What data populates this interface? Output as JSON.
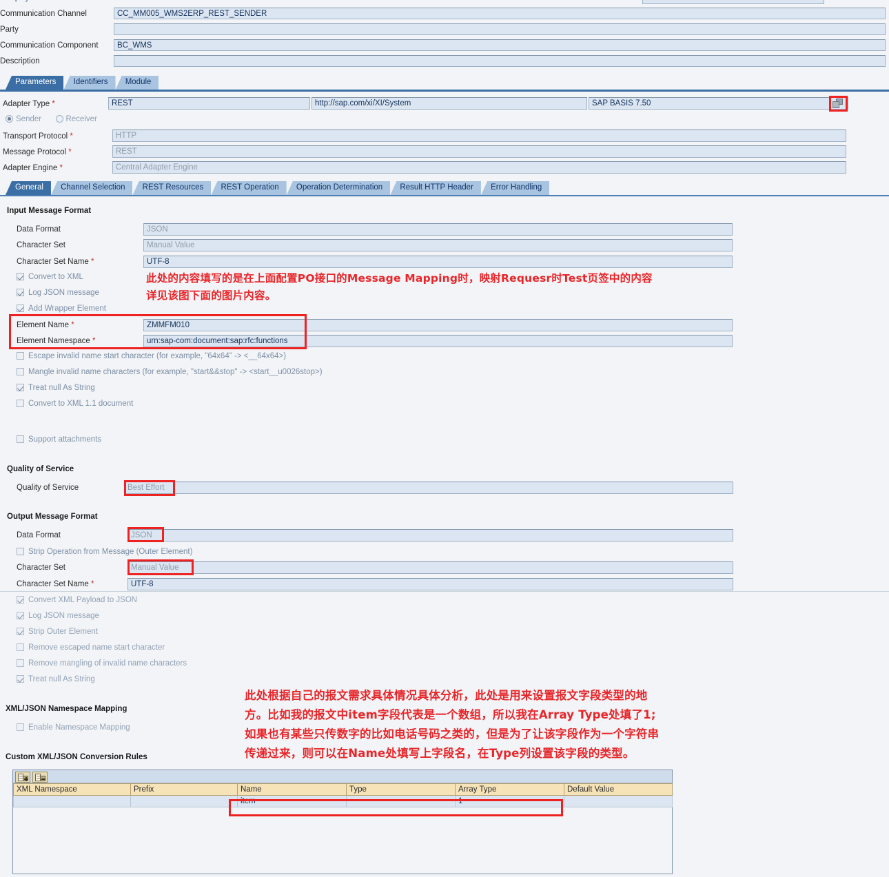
{
  "header": {
    "fields": [
      {
        "label": "Communication Channel",
        "value": "CC_MM005_WMS2ERP_REST_SENDER"
      },
      {
        "label": "Party",
        "value": ""
      },
      {
        "label": "Communication Component",
        "value": "BC_WMS"
      },
      {
        "label": "Description",
        "value": ""
      }
    ]
  },
  "main_tabs": [
    {
      "label": "Parameters",
      "active": true
    },
    {
      "label": "Identifiers",
      "active": false
    },
    {
      "label": "Module",
      "active": false
    }
  ],
  "adapter": {
    "type_label": "Adapter Type",
    "type_value": "REST",
    "type_namespace": "http://sap.com/xi/XI/System",
    "type_swcv": "SAP BASIS 7.50",
    "browse_icon": "stacked-squares-icon",
    "direction": {
      "sender": "Sender",
      "receiver": "Receiver",
      "selected": "Sender"
    },
    "rows": [
      {
        "label": "Transport Protocol",
        "value": "HTTP",
        "required": true
      },
      {
        "label": "Message Protocol",
        "value": "REST",
        "required": true
      },
      {
        "label": "Adapter Engine",
        "value": "Central Adapter Engine",
        "required": true
      }
    ]
  },
  "sub_tabs": [
    {
      "label": "General",
      "active": true
    },
    {
      "label": "Channel Selection",
      "active": false
    },
    {
      "label": "REST Resources",
      "active": false
    },
    {
      "label": "REST Operation",
      "active": false
    },
    {
      "label": "Operation Determination",
      "active": false
    },
    {
      "label": "Result HTTP Header",
      "active": false
    },
    {
      "label": "Error Handling",
      "active": false
    }
  ],
  "input_message_format": {
    "title": "Input Message Format",
    "data_format_label": "Data Format",
    "data_format_value": "JSON",
    "character_set_label": "Character Set",
    "character_set_value": "Manual Value",
    "character_set_name_label": "Character Set Name",
    "character_set_name_value": "UTF-8",
    "checkboxes": [
      {
        "label": "Convert to XML",
        "checked": true
      },
      {
        "label": "Log JSON message",
        "checked": true
      },
      {
        "label": "Add Wrapper Element",
        "checked": true
      }
    ],
    "element_name_label": "Element Name",
    "element_name_value": "ZMMFM010",
    "element_namespace_label": "Element Namespace",
    "element_namespace_value": "urn:sap-com:document:sap:rfc:functions",
    "checkboxes2": [
      {
        "label": "Escape invalid name start character (for example, \"64x64\" -> <__64x64>)",
        "checked": false
      },
      {
        "label": "Mangle invalid name characters (for example, \"start&&stop\" -> <start__u0026stop>)",
        "checked": false
      },
      {
        "label": "Treat null As String",
        "checked": true
      },
      {
        "label": "Convert to XML 1.1 document",
        "checked": false
      }
    ],
    "support_attachments": {
      "label": "Support attachments",
      "checked": false
    }
  },
  "quality_of_service": {
    "title": "Quality of Service",
    "label": "Quality of Service",
    "value": "Best Effort"
  },
  "output_message_format": {
    "title": "Output Message Format",
    "data_format_label": "Data Format",
    "data_format_value": "JSON",
    "strip_operation": {
      "label": "Strip Operation from Message (Outer Element)",
      "checked": false
    },
    "character_set_label": "Character Set",
    "character_set_value": "Manual Value",
    "character_set_name_label": "Character Set Name",
    "character_set_name_value": "UTF-8",
    "checkboxes": [
      {
        "label": "Convert XML Payload to JSON",
        "checked": true
      },
      {
        "label": "Log JSON message",
        "checked": true
      },
      {
        "label": "Strip Outer Element",
        "checked": true
      },
      {
        "label": "Remove escaped name start character",
        "checked": false
      },
      {
        "label": "Remove mangling of invalid name characters",
        "checked": false
      },
      {
        "label": "Treat null As String",
        "checked": true
      }
    ]
  },
  "namespace_mapping": {
    "title": "XML/JSON Namespace Mapping",
    "enable": {
      "label": "Enable Namespace Mapping",
      "checked": false
    }
  },
  "conversion_rules": {
    "title": "Custom XML/JSON Conversion Rules",
    "toolbar": [
      {
        "icon": "add-row-icon",
        "name": "add-row"
      },
      {
        "icon": "delete-row-icon",
        "name": "delete-row"
      }
    ],
    "columns": [
      "XML Namespace",
      "Prefix",
      "Name",
      "Type",
      "Array Type",
      "Default Value"
    ],
    "rows": [
      {
        "xml_namespace": "",
        "prefix": "",
        "name": "item",
        "type": "",
        "array_type": "1",
        "default_value": ""
      }
    ]
  },
  "annotations": {
    "note1": "此处的内容填写的是在上面配置PO接口的Message Mapping时，映射Requesr时Test页签中的内容\n详见该图下面的图片内容。",
    "note2": "此处根据自己的报文需求具体情况具体分析，此处是用来设置报文字段类型的地\n方。比如我的报文中item字段代表是一个数组，所以我在Array Type处填了1;\n如果也有某些只传数字的比如电话号码之类的，但是为了让该字段作为一个字符串\n传递过来，则可以在Name处填写上字段名，在Type列设置该字段的类型。",
    "highlight_color": "#EF2222"
  }
}
